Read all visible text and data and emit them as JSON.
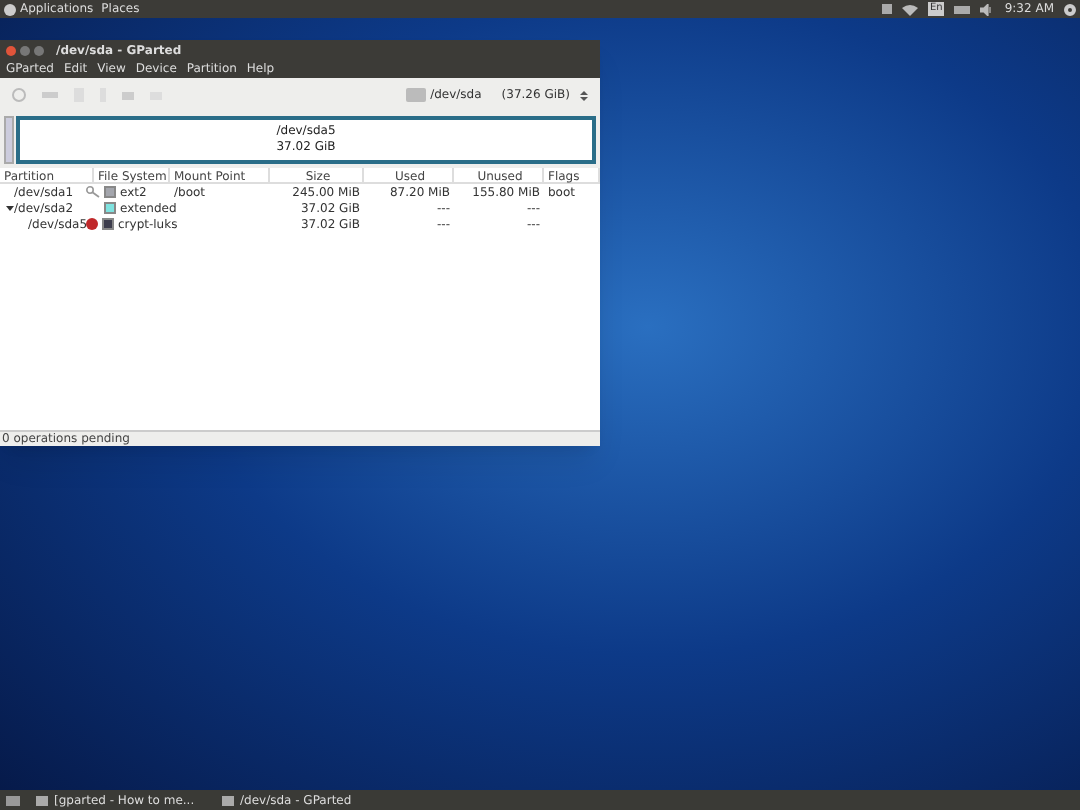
{
  "top_panel": {
    "menus": [
      "Applications",
      "Places"
    ],
    "keyboard": "En",
    "clock": "9:32 AM"
  },
  "window": {
    "title": "/dev/sda - GParted",
    "menu": [
      "GParted",
      "Edit",
      "View",
      "Device",
      "Partition",
      "Help"
    ],
    "device": {
      "name": "/dev/sda",
      "size": "(37.26 GiB)"
    },
    "graph": {
      "name": "/dev/sda5",
      "size": "37.02 GiB"
    },
    "table": {
      "columns": [
        "Partition",
        "File System",
        "Mount Point",
        "Size",
        "Used",
        "Unused",
        "Flags"
      ],
      "rows": [
        {
          "partition": "/dev/sda1",
          "kind": "mounted",
          "fs": "ext2",
          "color": "#a4a6ad",
          "mount": "/boot",
          "size": "245.00 MiB",
          "used": "87.20 MiB",
          "unused": "155.80 MiB",
          "flags": "boot"
        },
        {
          "partition": "/dev/sda2",
          "kind": "plain",
          "fs": "extended",
          "color": "#7fe3e0",
          "size": "37.02 GiB",
          "used": "---",
          "unused": "---",
          "expanded": true,
          "children": [
            {
              "partition": "/dev/sda5",
              "kind": "warning",
              "fs": "crypt-luks",
              "color": "#3d3d4d",
              "size": "37.02 GiB",
              "used": "---",
              "unused": "---"
            }
          ]
        }
      ]
    },
    "status_bar": "0 operations pending"
  },
  "taskbar": [
    "[gparted - How to me...",
    "/dev/sda - GParted"
  ]
}
